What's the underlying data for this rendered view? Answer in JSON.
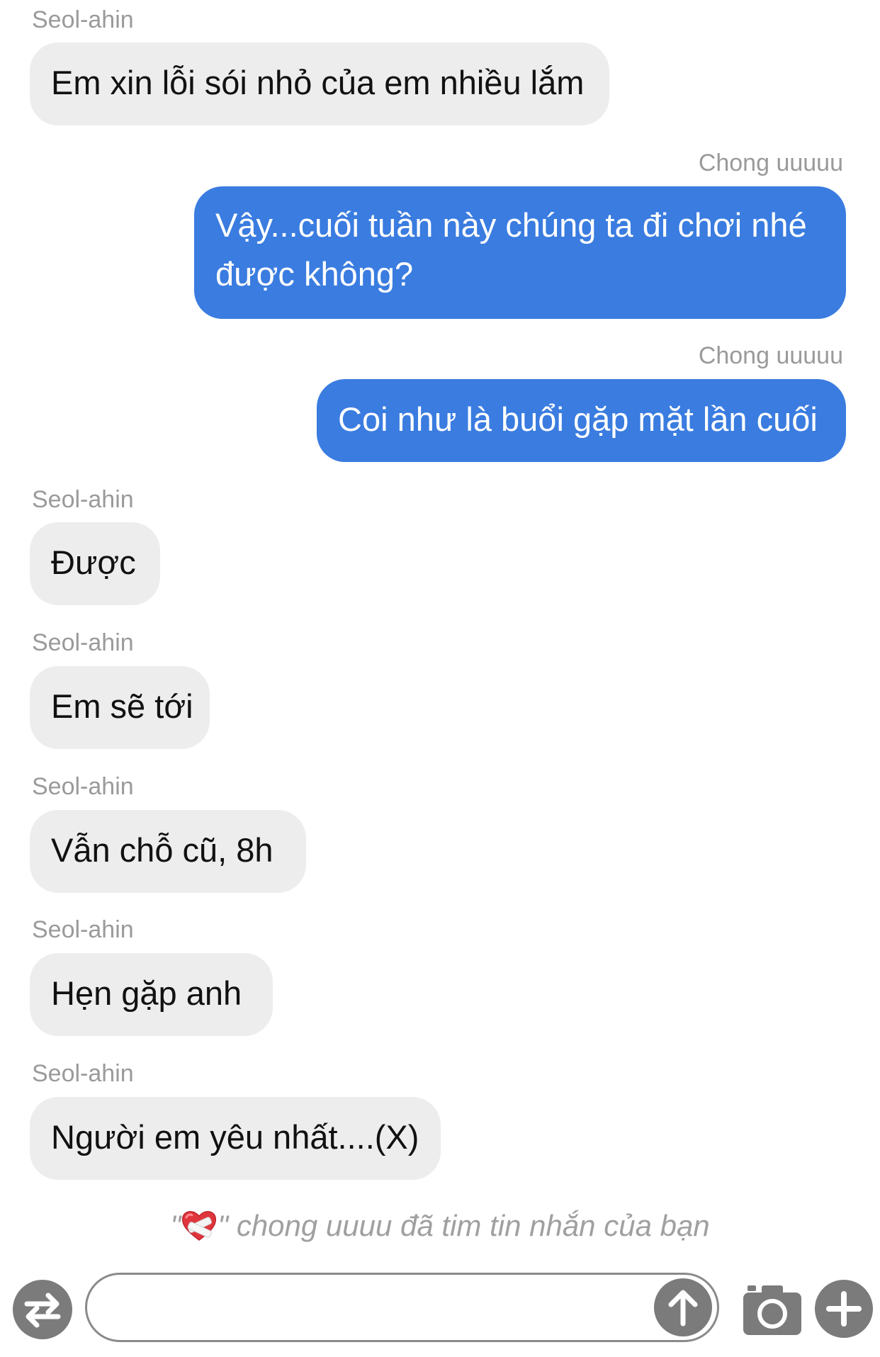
{
  "messages": [
    {
      "sender": "Seol-ahin",
      "text": "Em xin lỗi sói nhỏ của em nhiều lắm",
      "direction": "incoming"
    },
    {
      "sender": "Chong uuuuu",
      "text": "Vậy...cuối tuần này chúng ta đi chơi nhé được không?",
      "direction": "outgoing"
    },
    {
      "sender": "Chong uuuuu",
      "text": "Coi như là buổi gặp mặt lần cuối",
      "direction": "outgoing"
    },
    {
      "sender": "Seol-ahin",
      "text": "Được",
      "direction": "incoming"
    },
    {
      "sender": "Seol-ahin",
      "text": "Em sẽ tới",
      "direction": "incoming"
    },
    {
      "sender": "Seol-ahin",
      "text": "Vẫn chỗ cũ, 8h",
      "direction": "incoming"
    },
    {
      "sender": "Seol-ahin",
      "text": "Hẹn gặp anh",
      "direction": "incoming"
    },
    {
      "sender": "Seol-ahin",
      "text": "Người em yêu nhất....(X)",
      "direction": "incoming"
    }
  ],
  "reaction_notice": {
    "quote_open": "\"",
    "quote_close": "\"",
    "text": "chong uuuu đã tim tin nhắn của bạn",
    "icon": "heart-with-bandage-icon"
  },
  "composer": {
    "input_value": "",
    "input_placeholder": "",
    "icons": [
      "swap-arrows-icon",
      "send-arrow-up-icon",
      "camera-icon",
      "plus-icon"
    ]
  },
  "colors": {
    "incoming_bubble": "#ededed",
    "outgoing_bubble": "#3a7ce0",
    "sender_text": "#9a9a9a",
    "icon_gray": "#7b7b7b"
  }
}
